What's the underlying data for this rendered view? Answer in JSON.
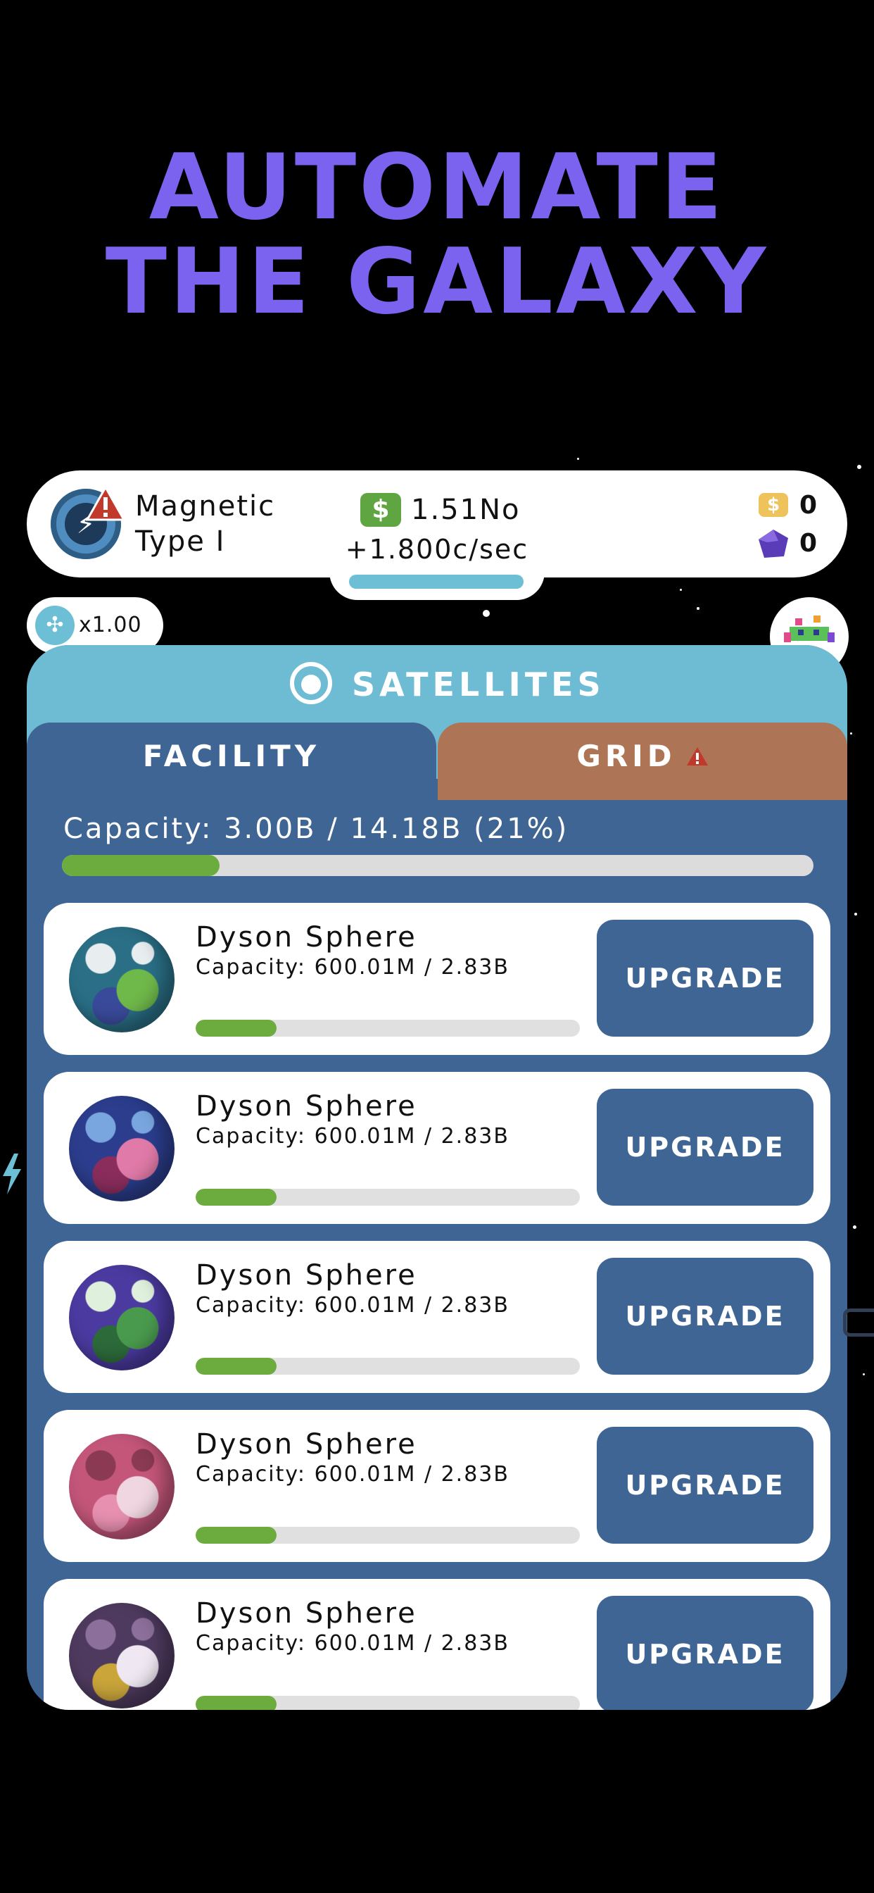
{
  "promo": {
    "line1": "AUTOMATE",
    "line2": "THE GALAXY"
  },
  "status_bar": {
    "level_name_line1": "Magnetic",
    "level_name_line2": "Type I",
    "money_symbol": "$",
    "money": "1.51No",
    "rate": "+1.800c/sec",
    "coins": "0",
    "gems": "0",
    "coin_symbol": "$"
  },
  "boost": {
    "multiplier": "x1.00"
  },
  "panel": {
    "title": "SATELLITES",
    "tabs": [
      {
        "label": "FACILITY",
        "active": true
      },
      {
        "label": "GRID",
        "active": false,
        "warning": true
      }
    ],
    "capacity_label": "Capacity: 3.00B / 14.18B (21%)",
    "capacity_fraction": 0.21,
    "facilities": [
      {
        "name": "Dyson Sphere",
        "capacity": "Capacity: 600.01M / 2.83B",
        "fraction": 0.21,
        "button": "UPGRADE",
        "planet_colors": [
          "#2a6f86",
          "#6fb84a",
          "#e8eef0",
          "#3a4a9a"
        ]
      },
      {
        "name": "Dyson Sphere",
        "capacity": "Capacity: 600.01M / 2.83B",
        "fraction": 0.21,
        "button": "UPGRADE",
        "planet_colors": [
          "#2b3d8c",
          "#e07aa8",
          "#7aa6e0",
          "#8a2d5c"
        ]
      },
      {
        "name": "Dyson Sphere",
        "capacity": "Capacity: 600.01M / 2.83B",
        "fraction": 0.21,
        "button": "UPGRADE",
        "planet_colors": [
          "#4b3aa0",
          "#4a9a4e",
          "#dff0dc",
          "#2c6a3a"
        ]
      },
      {
        "name": "Dyson Sphere",
        "capacity": "Capacity: 600.01M / 2.83B",
        "fraction": 0.21,
        "button": "UPGRADE",
        "planet_colors": [
          "#c4567a",
          "#f0d6e0",
          "#8a3a52",
          "#e890b0"
        ]
      },
      {
        "name": "Dyson Sphere",
        "capacity": "Capacity: 600.01M / 2.83B",
        "fraction": 0.21,
        "button": "UPGRADE",
        "planet_colors": [
          "#4e3a5e",
          "#efe8f2",
          "#8c6f9a",
          "#c9a53a"
        ]
      }
    ]
  },
  "colors": {
    "promo": "#7b63f0",
    "panel": "#3e6593",
    "header": "#6ebcd4",
    "grid_tab": "#ad7556",
    "progress": "#6cab3d",
    "warning": "#c0392b"
  }
}
